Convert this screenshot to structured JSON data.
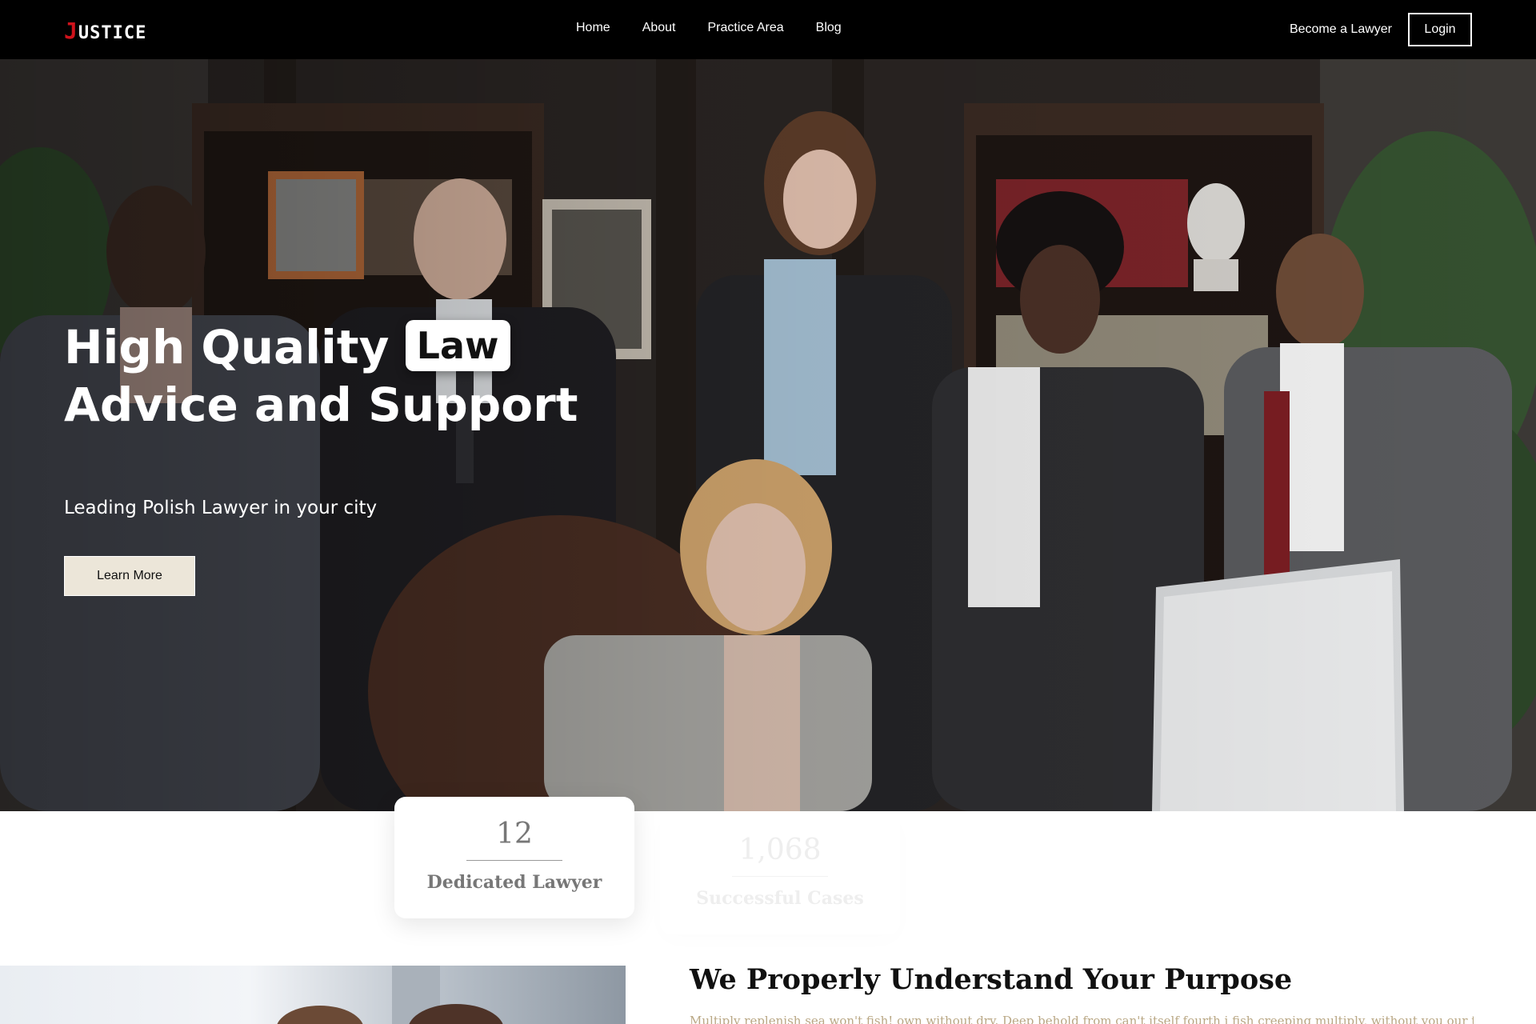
{
  "navbar": {
    "logo_first_letter": "J",
    "logo_rest": "USTICE",
    "links": [
      {
        "label": "Home"
      },
      {
        "label": "About"
      },
      {
        "label": "Practice Area"
      },
      {
        "label": "Blog"
      }
    ],
    "become_lawyer_label": "Become a Lawyer",
    "login_label": "Login"
  },
  "hero": {
    "title_line1_start": "High Quality",
    "title_highlight": "Law",
    "title_line2": "Advice and Support",
    "subtitle": "Leading Polish Lawyer in your city",
    "cta_label": "Learn More"
  },
  "stats": [
    {
      "number": "12",
      "label": "Dedicated Lawyer"
    },
    {
      "number": "1,068",
      "label": "Successful Cases"
    }
  ],
  "purpose": {
    "title": "We Properly Understand Your Purpose",
    "text": "Multiply replenish sea won't fish! own without dry. Deep behold from can't itself fourth i fish creeping multiply, without you our they dry"
  },
  "colors": {
    "accent_red": "#d0121b",
    "cta_bg": "#ece6d9",
    "navbar_bg": "#000000",
    "purpose_text": "#b9a784"
  }
}
